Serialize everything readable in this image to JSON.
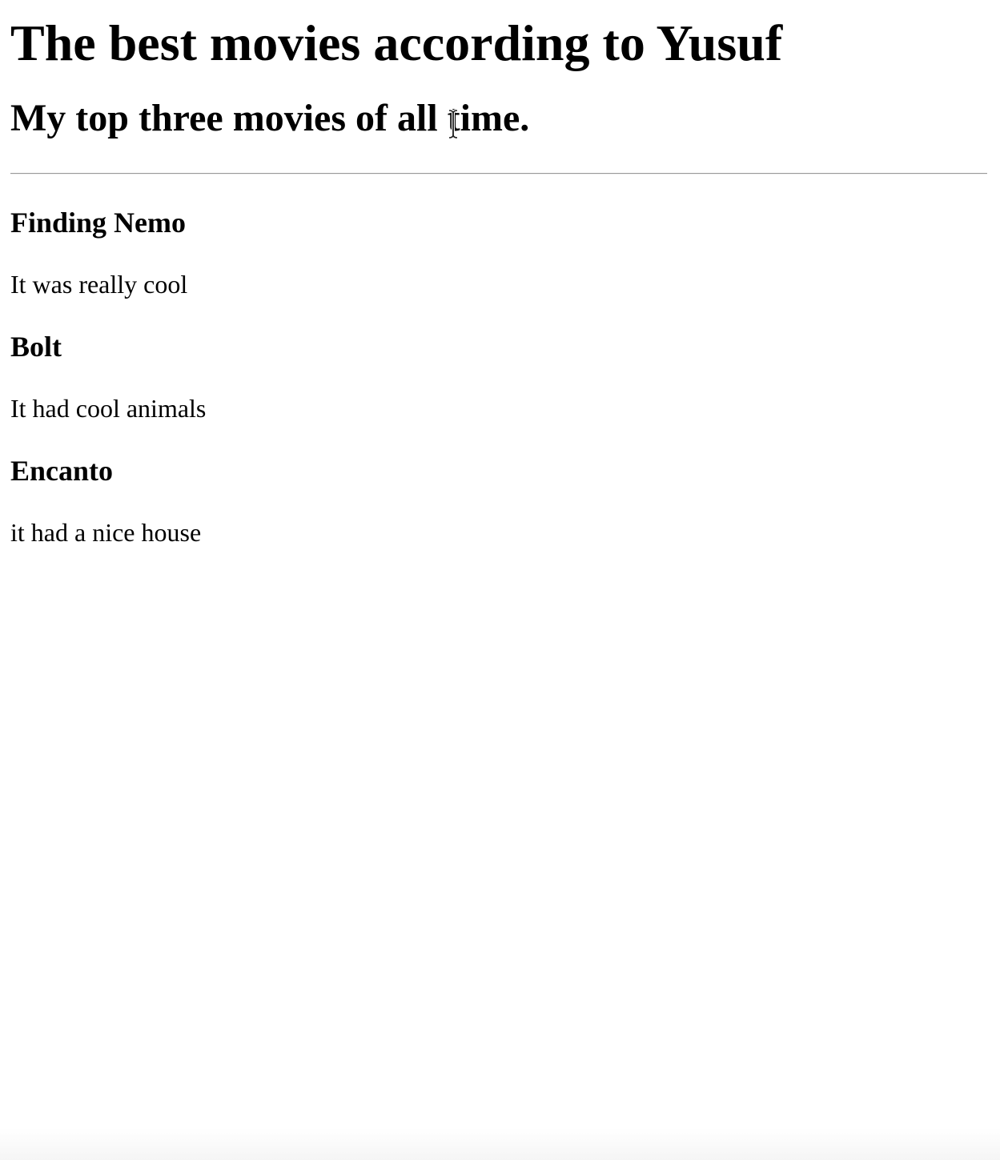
{
  "page": {
    "title": "The best movies according to Yusuf",
    "subtitle": "My top three movies of all time."
  },
  "movies": [
    {
      "title": "Finding Nemo",
      "description": "It was really cool"
    },
    {
      "title": "Bolt",
      "description": "It had cool animals"
    },
    {
      "title": "Encanto",
      "description": "it had a nice house"
    }
  ],
  "cursor": {
    "icon": "text-cursor-icon"
  }
}
